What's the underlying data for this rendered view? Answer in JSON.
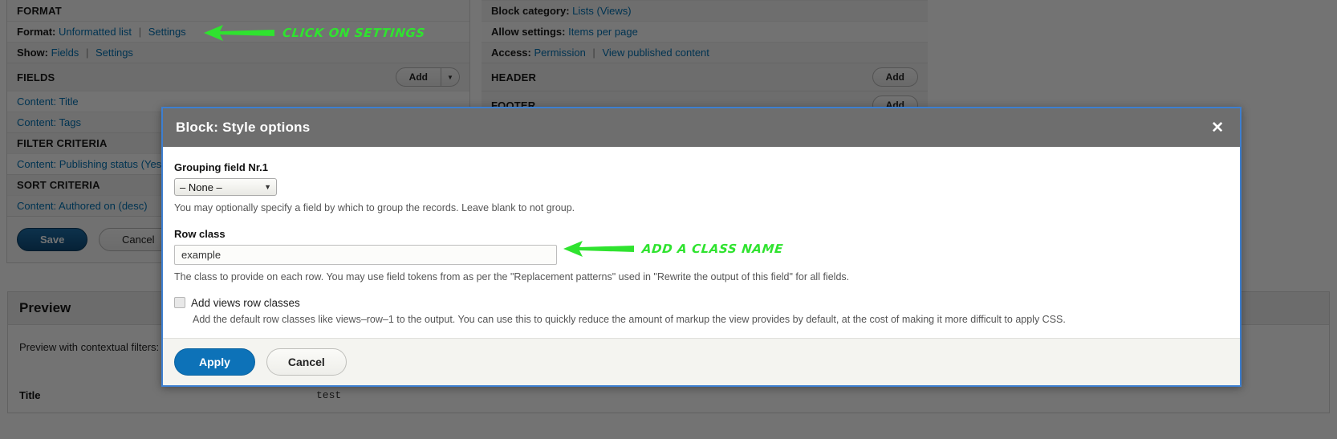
{
  "background": {
    "left_panel": {
      "format_section": {
        "title": "FORMAT",
        "format_label": "Format:",
        "format_value": "Unformatted list",
        "format_settings": "Settings",
        "show_label": "Show:",
        "show_value": "Fields",
        "show_settings": "Settings"
      },
      "fields_section": {
        "title": "FIELDS",
        "add_label": "Add",
        "items": [
          "Content: Title",
          "Content: Tags"
        ]
      },
      "filter_section": {
        "title": "FILTER CRITERIA",
        "items": [
          "Content: Publishing status (Yes"
        ]
      },
      "sort_section": {
        "title": "SORT CRITERIA",
        "items": [
          "Content: Authored on (desc)"
        ]
      },
      "actions": {
        "save_label": "Save",
        "cancel_label": "Cancel"
      }
    },
    "right_panel": {
      "block_category_label": "Block category:",
      "block_category_value": "Lists (Views)",
      "allow_settings_label": "Allow settings:",
      "allow_settings_value": "Items per page",
      "access_label": "Access:",
      "access_value": "Permission",
      "access_value2": "View published content",
      "header_title": "HEADER",
      "header_add": "Add",
      "footer_title": "FOOTER",
      "footer_add": "Add"
    },
    "preview": {
      "title": "Preview",
      "filters_label": "Preview with contextual filters:",
      "table_header": "Title",
      "table_value": "test"
    }
  },
  "modal": {
    "title": "Block: Style options",
    "close_label": "✕",
    "grouping": {
      "label": "Grouping field Nr.1",
      "selected": "– None –",
      "description": "You may optionally specify a field by which to group the records. Leave blank to not group."
    },
    "row_class": {
      "label": "Row class",
      "value": "example",
      "placeholder": "",
      "description": "The class to provide on each row. You may use field tokens from as per the \"Replacement patterns\" used in \"Rewrite the output of this field\" for all fields."
    },
    "add_views_row_classes": {
      "label": "Add views row classes",
      "checked": false,
      "description": "Add the default row classes like views–row–1 to the output. You can use this to quickly reduce the amount of markup the view provides by default, at the cost of making it more difficult to apply CSS."
    },
    "footer": {
      "apply_label": "Apply",
      "cancel_label": "Cancel"
    }
  },
  "annotations": [
    {
      "text": "CLICK ON SETTINGS",
      "color": "#2fe32f"
    },
    {
      "text": "ADD A CLASS NAME",
      "color": "#2fe32f"
    }
  ]
}
